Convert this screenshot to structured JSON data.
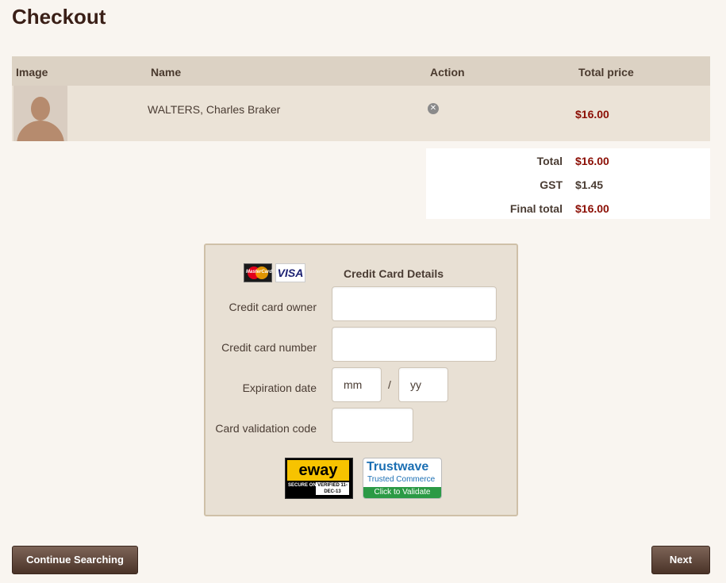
{
  "page": {
    "title": "Checkout"
  },
  "cart": {
    "columns": [
      "Image",
      "Name",
      "Action",
      "Total price"
    ],
    "items": [
      {
        "name": "WALTERS, Charles Braker",
        "total_price": "$16.00"
      }
    ]
  },
  "totals": {
    "total_label": "Total",
    "total_value": "$16.00",
    "gst_label": "GST",
    "gst_value": "$1.45",
    "final_label": "Final total",
    "final_value": "$16.00"
  },
  "credit_card": {
    "title": "Credit Card Details",
    "logos": {
      "mastercard_text": "MasterCard",
      "visa_text": "VISA"
    },
    "owner_label": "Credit card owner",
    "number_label": "Credit card number",
    "expiration_label": "Expiration date",
    "month_placeholder": "mm",
    "year_placeholder": "yy",
    "expiration_separator": "/",
    "cvc_label": "Card validation code"
  },
  "badges": {
    "eway": {
      "brand": "eway",
      "left": "SECURE ONLINE",
      "right": "VERIFIED 11-DEC-13"
    },
    "trustwave": {
      "brand": "Trustwave",
      "sub": "Trusted Commerce",
      "cta": "Click to Validate"
    }
  },
  "buttons": {
    "continue": "Continue Searching",
    "next": "Next"
  },
  "colors": {
    "accent_price": "#8b0e04",
    "button": "#5e4538",
    "table_header": "#dcd2c4"
  }
}
